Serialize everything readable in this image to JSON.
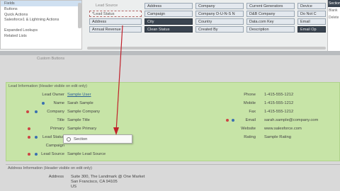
{
  "left_panel": {
    "items": [
      "Fields",
      "Buttons",
      "Quick Actions",
      "Salesforce1 & Lightning Actions",
      "Expanded Lookups",
      "Related Lists"
    ]
  },
  "field_grid": {
    "row0": [
      "Lead Source",
      "Address",
      "Company",
      "Current Generators",
      "Device"
    ],
    "row1": [
      "*Lead Status",
      "Campaign",
      "Company D-U-N-S N",
      "D&B Company",
      "Do Not C"
    ],
    "row2": [
      "Address",
      "City",
      "Country",
      "Data.com Key",
      "Email"
    ],
    "row3": [
      "Annual Revenue",
      "Clean Status",
      "Created By",
      "Description",
      "Email Op"
    ],
    "right_nav": [
      "Section",
      "Blank",
      "Delete"
    ]
  },
  "custom_buttons_label": "Custom Buttons",
  "lead_section": {
    "header": "Lead Information  (Header visible on edit only)",
    "left_fields": [
      {
        "label": "Lead Owner",
        "value": "Sample User",
        "link": true
      },
      {
        "label": "Name",
        "value": "Sarah Sample",
        "link": false
      },
      {
        "label": "Company",
        "value": "Sample Company",
        "link": false
      },
      {
        "label": "Title",
        "value": "Sample Title",
        "link": false
      },
      {
        "label": "Primary",
        "value": "Sample Primary",
        "link": false
      },
      {
        "label": "Lead Status",
        "value": "",
        "link": false
      },
      {
        "label": "Campaign",
        "value": "",
        "link": false
      },
      {
        "label": "Lead Source",
        "value": "Sample Lead Source",
        "link": false
      }
    ],
    "right_fields": [
      {
        "label": "Phone",
        "value": "1-415-555-1212",
        "link": false
      },
      {
        "label": "Mobile",
        "value": "1-415-555-1212",
        "link": false
      },
      {
        "label": "Fax",
        "value": "1-415-555-1212",
        "link": false
      },
      {
        "label": "Email",
        "value": "sarah.sample@company.com",
        "link": false
      },
      {
        "label": "Website",
        "value": "www.salesforce.com",
        "link": false
      },
      {
        "label": "Rating",
        "value": "Sample Rating",
        "link": false
      }
    ],
    "tooltip_label": "Section"
  },
  "address_section": {
    "header": "Address Information  (Header visible on edit only)",
    "label": "Address",
    "lines": [
      "Suite 300, The Landmark @ One Market",
      "San Francisco, CA 94105",
      "US"
    ]
  },
  "colors": {
    "lead_bg": "#c7e4a7",
    "arrow": "#c0202a",
    "link": "#2a5f96"
  }
}
